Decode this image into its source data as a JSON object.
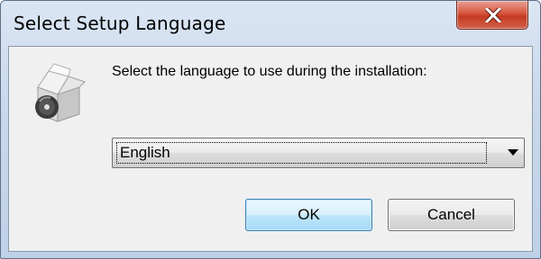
{
  "window": {
    "title": "Select Setup Language",
    "close_icon": "close-x-icon",
    "app_icon": "setup-installer-icon"
  },
  "dialog": {
    "prompt": "Select the language to use during the installation:",
    "language_select": {
      "selected": "English",
      "arrow_icon": "dropdown-arrow-icon"
    },
    "buttons": {
      "ok_label": "OK",
      "cancel_label": "Cancel"
    }
  },
  "colors": {
    "titlebar": "#c9d8ec",
    "close_button": "#c43a22",
    "client_bg": "#f0f0f0",
    "ok_button": "#bee6fd"
  }
}
